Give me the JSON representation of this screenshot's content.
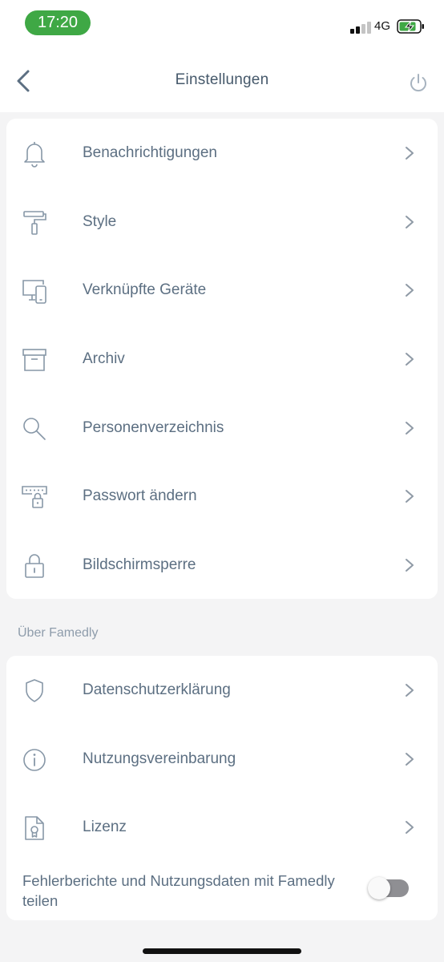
{
  "status_bar": {
    "time": "17:20",
    "network": "4G"
  },
  "header": {
    "title": "Einstellungen"
  },
  "settings": [
    {
      "label": "Benachrichtigungen",
      "icon": "bell-icon"
    },
    {
      "label": "Style",
      "icon": "paint-roller-icon"
    },
    {
      "label": "Verknüpfte Geräte",
      "icon": "devices-icon"
    },
    {
      "label": "Archiv",
      "icon": "archive-icon"
    },
    {
      "label": "Personenverzeichnis",
      "icon": "search-icon"
    },
    {
      "label": "Passwort ändern",
      "icon": "password-lock-icon"
    },
    {
      "label": "Bildschirmsperre",
      "icon": "lock-icon"
    }
  ],
  "about": {
    "section_label": "Über Famedly",
    "items": [
      {
        "label": "Datenschutzerklärung",
        "icon": "shield-icon"
      },
      {
        "label": "Nutzungsvereinbarung",
        "icon": "info-icon"
      },
      {
        "label": "Lizenz",
        "icon": "license-icon"
      }
    ],
    "toggle_label": "Fehlerberichte und Nutzungsdaten mit Famedly teilen",
    "toggle_on": false
  },
  "colors": {
    "accent": "#3fa845",
    "text": "#5c6f82",
    "background": "#f4f4f5"
  }
}
